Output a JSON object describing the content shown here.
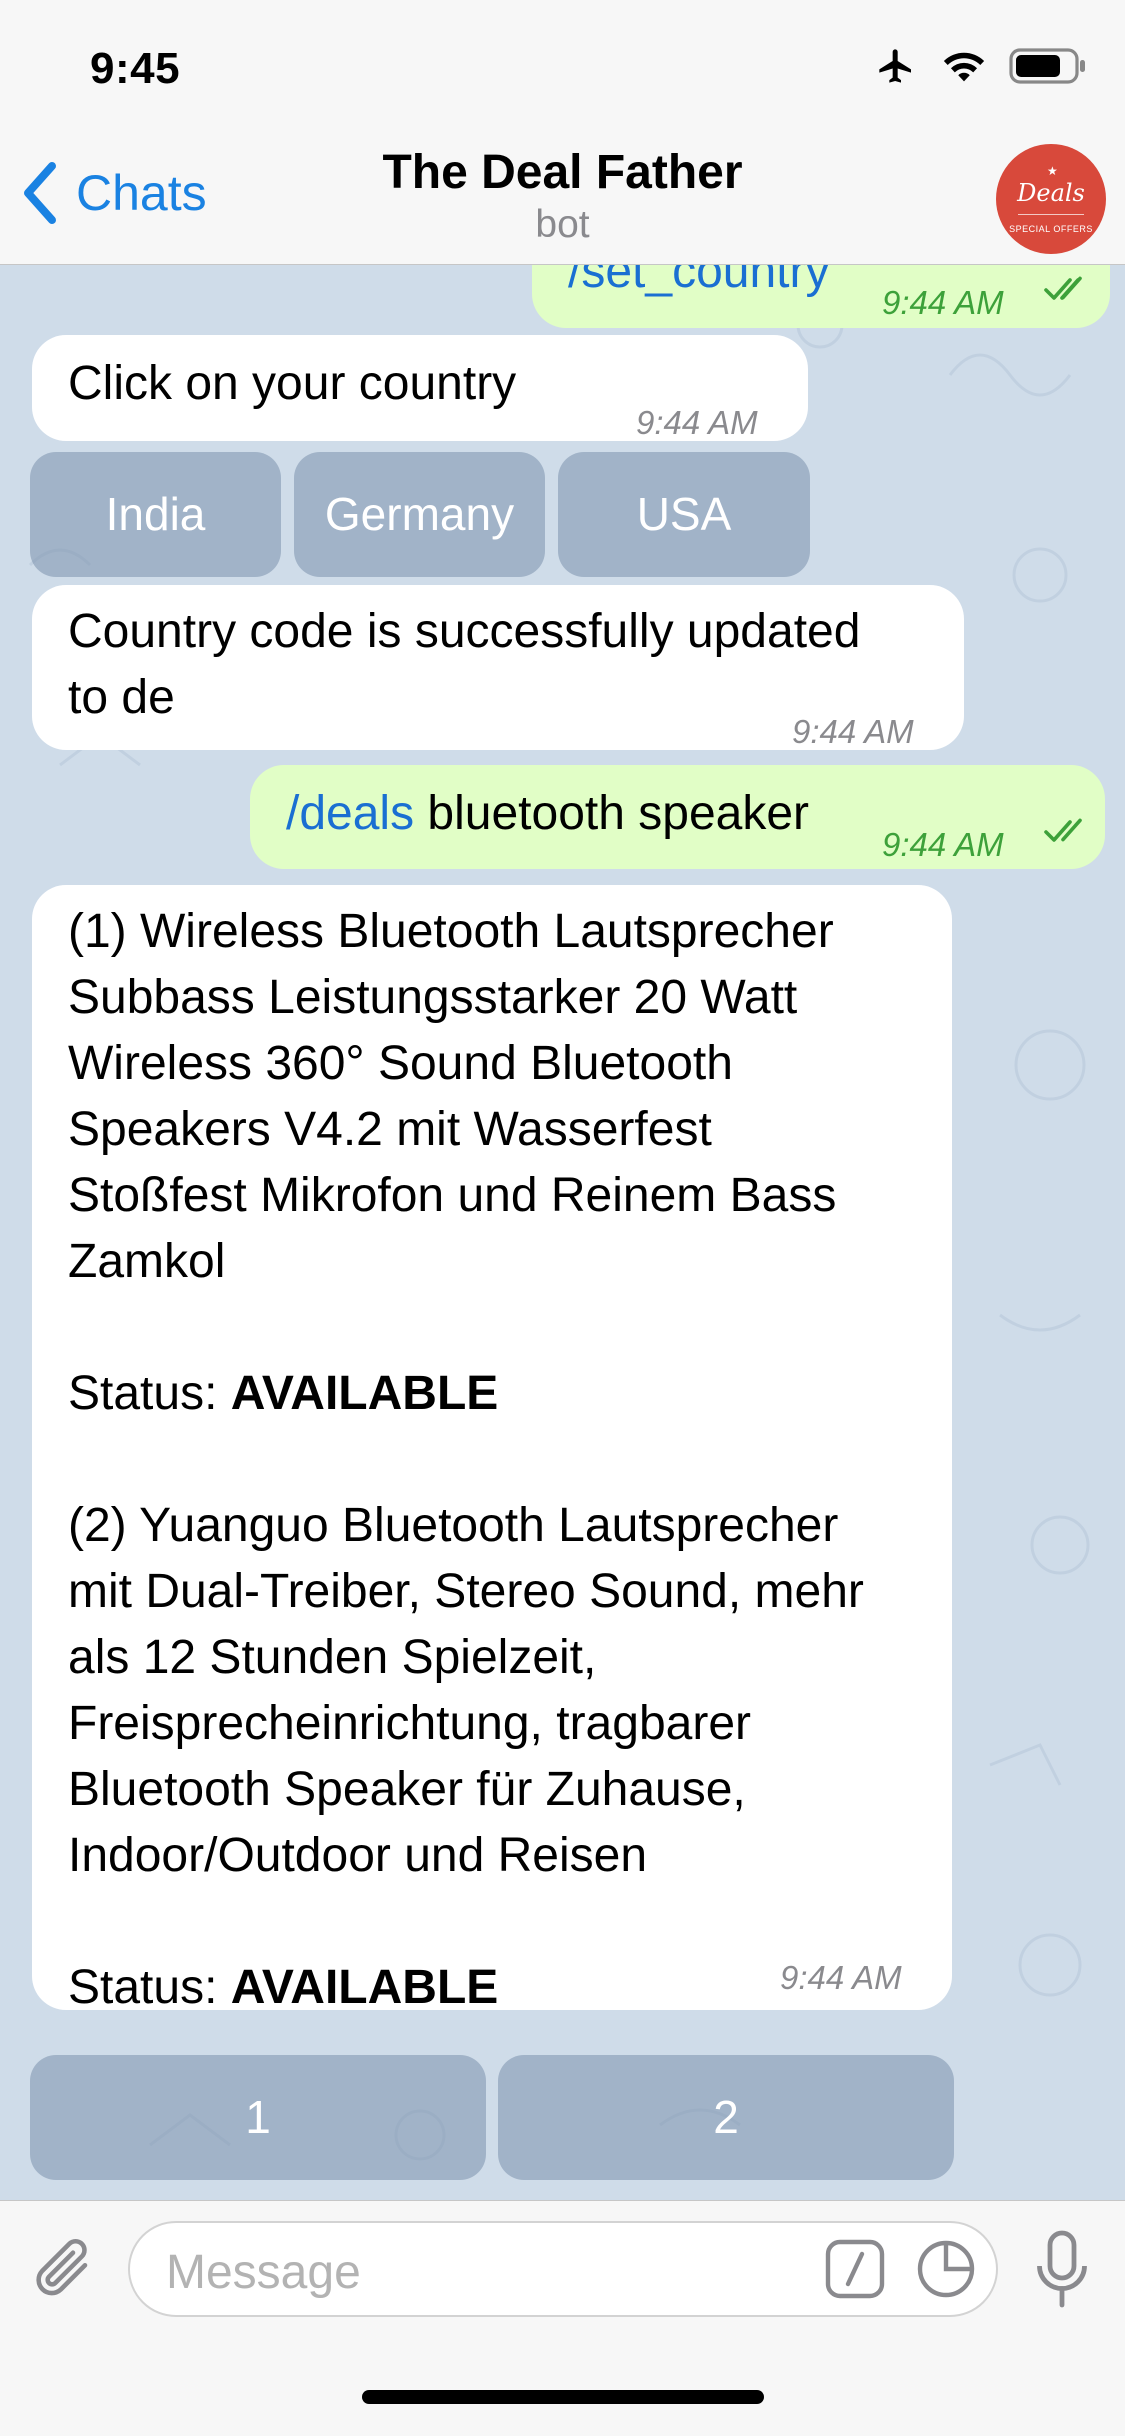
{
  "status_bar": {
    "time": "9:45"
  },
  "nav": {
    "back_label": "Chats",
    "title": "The Deal Father",
    "subtitle": "bot",
    "avatar_text": "Deals",
    "avatar_sub": "SPECIAL OFFERS"
  },
  "messages": {
    "set_country": {
      "text": "/set_country",
      "time": "9:44 AM"
    },
    "click_country": {
      "text": "Click on your country",
      "time": "9:44 AM"
    },
    "country_buttons": [
      "India",
      "Germany",
      "USA"
    ],
    "country_updated": {
      "line1": "Country code is successfully updated",
      "line2": "to de",
      "time": "9:44 AM"
    },
    "deals": {
      "command": "/deals",
      "query": " bluetooth speaker",
      "time": "9:44 AM"
    },
    "results": {
      "item1_lines": [
        "(1) Wireless Bluetooth Lautsprecher",
        "Subbass Leistungsstarker 20 Watt",
        "Wireless 360° Sound Bluetooth",
        "Speakers V4.2 mit Wasserfest",
        "Stoßfest Mikrofon und Reinem Bass",
        "Zamkol"
      ],
      "status_label": "Status: ",
      "status_value": "AVAILABLE",
      "item2_lines": [
        "(2) Yuanguo Bluetooth Lautsprecher",
        "mit Dual-Treiber, Stereo Sound, mehr",
        "als 12 Stunden Spielzeit,",
        "Freisprecheinrichtung, tragbarer",
        "Bluetooth Speaker für Zuhause,",
        "Indoor/Outdoor und Reisen"
      ],
      "time": "9:44 AM"
    },
    "page_buttons": [
      "1",
      "2"
    ]
  },
  "input": {
    "placeholder": "Message"
  },
  "colors": {
    "accent": "#1a82e2",
    "outgoing": "#e1fec6",
    "incoming": "#ffffff",
    "wallpaper": "#cfdce9",
    "check": "#3da13a"
  },
  "icons": [
    "airplane-icon",
    "wifi-icon",
    "battery-icon",
    "back-chevron-icon",
    "attach-icon",
    "slash-command-icon",
    "sticker-icon",
    "microphone-icon",
    "double-check-icon"
  ]
}
